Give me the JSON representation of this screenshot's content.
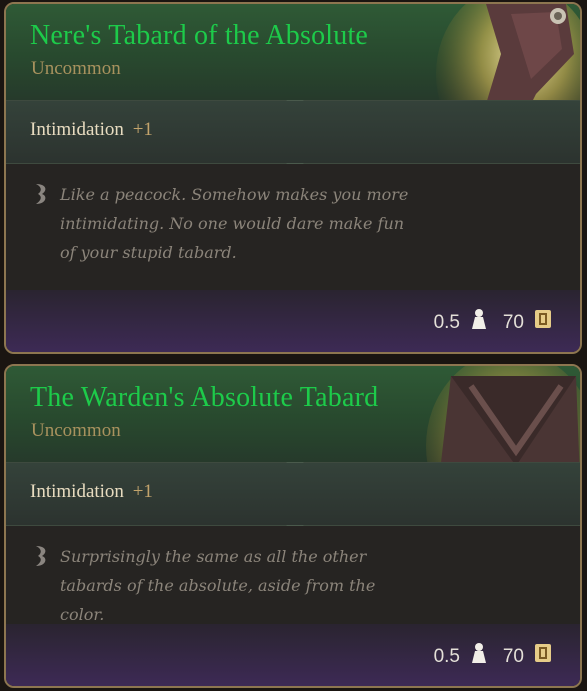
{
  "items": [
    {
      "title": "Nere's Tabard of the Absolute",
      "rarity": "Uncommon",
      "stat_name": "Intimidation",
      "stat_bonus": "+1",
      "description": "Like a peacock. Somehow makes you more intimidating. No one would dare make fun of your stupid tabard.",
      "weight": "0.5",
      "price": "70",
      "icons": {
        "weight": "weight-icon",
        "price": "coin-icon",
        "quill": "quill-icon"
      }
    },
    {
      "title": "The Warden's Absolute Tabard",
      "rarity": "Uncommon",
      "stat_name": "Intimidation",
      "stat_bonus": "+1",
      "description": "Surprisingly the same as all the other tabards of the absolute, aside from the color.",
      "weight": "0.5",
      "price": "70",
      "icons": {
        "weight": "weight-icon",
        "price": "coin-icon",
        "quill": "quill-icon"
      }
    }
  ],
  "colors": {
    "title": "#1dcb4a",
    "rarity": "#a8925e",
    "stat_bonus": "#c3a46c",
    "border": "#8d7650",
    "footer_purple": "#3d2a55"
  }
}
